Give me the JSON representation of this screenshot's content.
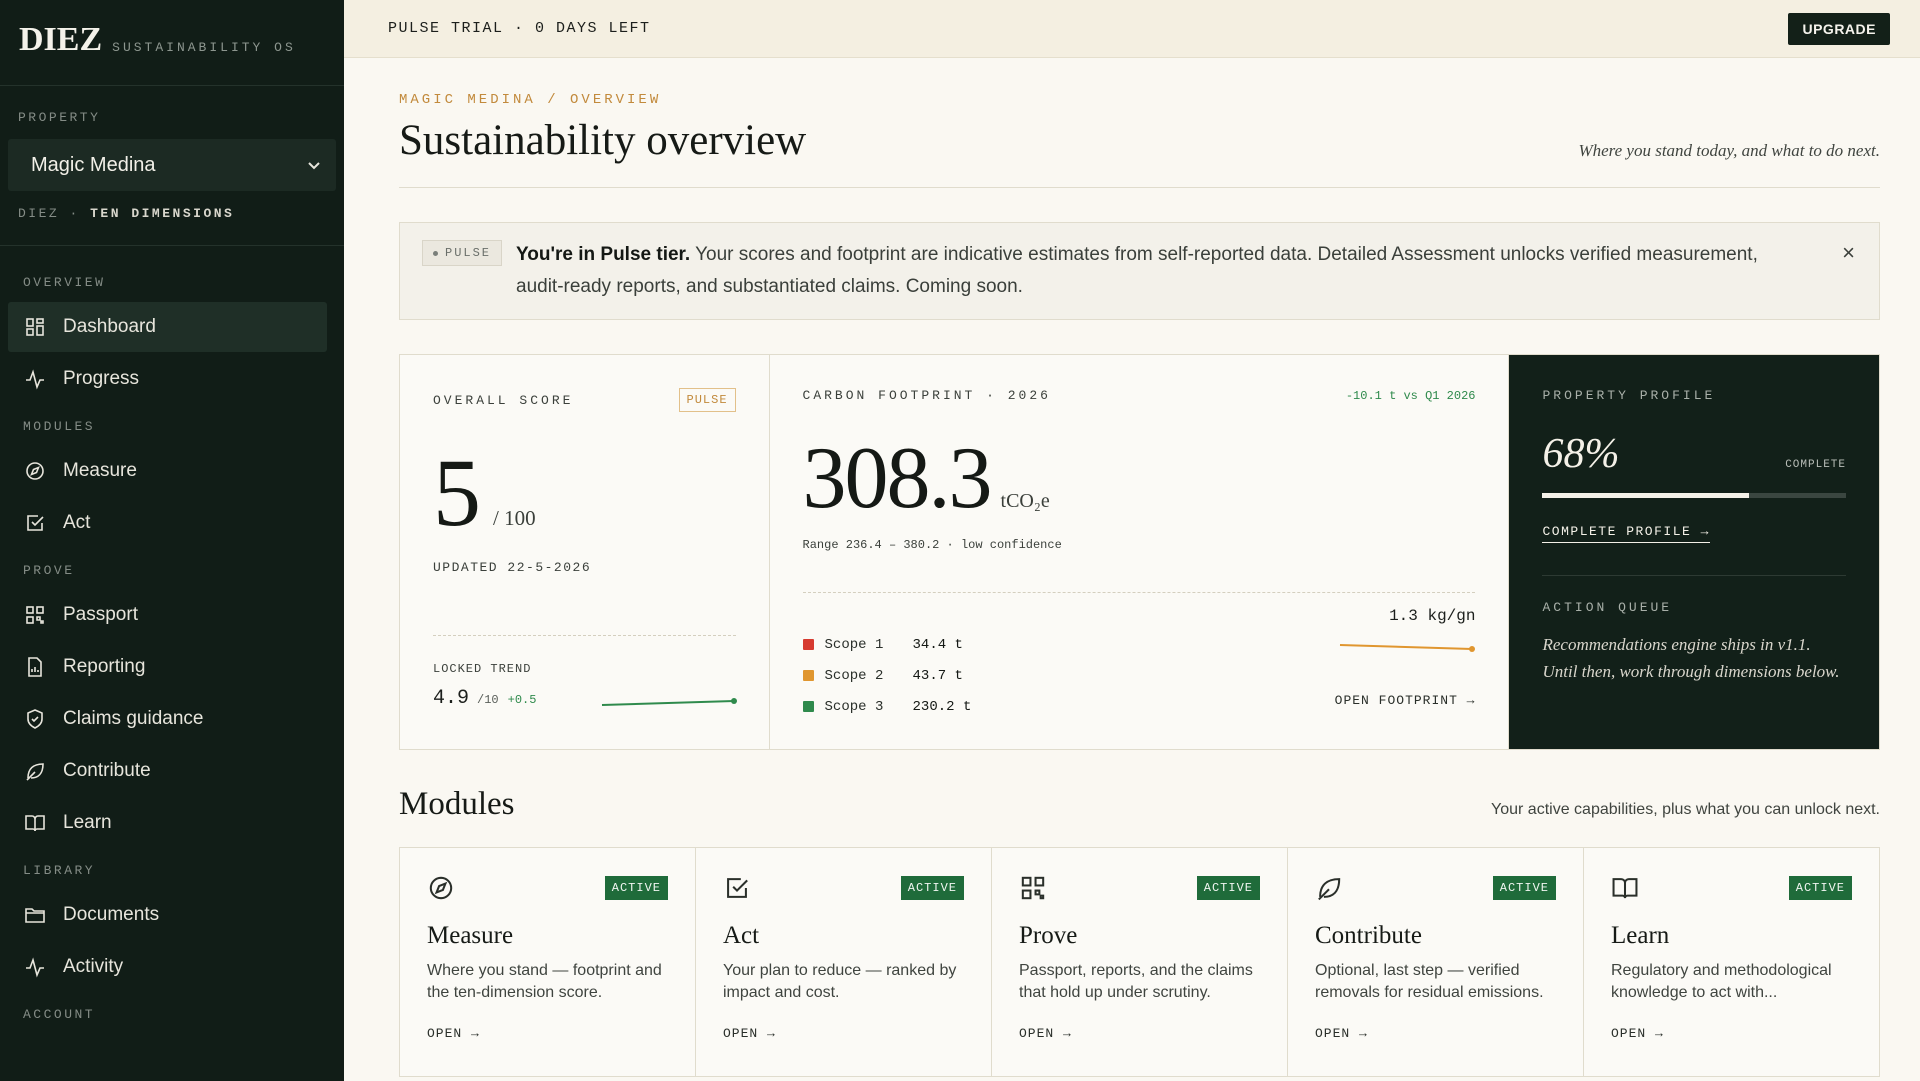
{
  "topbar": {
    "trial_text": "PULSE TRIAL · 0 DAYS LEFT",
    "upgrade_label": "UPGRADE"
  },
  "sidebar": {
    "brand": "DIEZ",
    "brand_sub": "SUSTAINABILITY OS",
    "property_label": "PROPERTY",
    "property_value": "Magic Medina",
    "property_org": "DIEZ",
    "property_sep": " · ",
    "property_org_sub": "TEN DIMENSIONS",
    "sections": {
      "overview": "OVERVIEW",
      "modules": "MODULES",
      "prove": "PROVE",
      "library": "LIBRARY",
      "account": "ACCOUNT"
    },
    "items": {
      "dashboard": "Dashboard",
      "progress": "Progress",
      "measure": "Measure",
      "act": "Act",
      "passport": "Passport",
      "reporting": "Reporting",
      "claims": "Claims guidance",
      "contribute": "Contribute",
      "learn": "Learn",
      "documents": "Documents",
      "activity": "Activity"
    }
  },
  "main": {
    "breadcrumb": "MAGIC MEDINA / OVERVIEW",
    "title": "Sustainability overview",
    "subtitle": "Where you stand today, and what to do next.",
    "banner": {
      "chip": "PULSE",
      "bold": "You're in Pulse tier.",
      "text": " Your scores and footprint are indicative estimates from self-reported data. Detailed Assessment unlocks verified measurement, audit-ready reports, and substantiated claims. Coming soon.",
      "close": "×"
    },
    "score_card": {
      "label": "OVERALL SCORE",
      "tag": "PULSE",
      "score": "5",
      "denominator": "/ 100",
      "updated": "UPDATED 22-5-2026",
      "locked_label": "LOCKED TREND",
      "trend_value": "4.9",
      "trend_den": "/10",
      "trend_delta": "+0.5"
    },
    "carbon_card": {
      "label": "CARBON FOOTPRINT · 2026",
      "delta": "-10.1 t vs Q1 2026",
      "value": "308.3",
      "unit": "tCO₂e",
      "range": "Range 236.4 – 380.2 · low confidence",
      "scopes": [
        {
          "name": "Scope 1",
          "value": "34.4 t",
          "color": "#d63a2f"
        },
        {
          "name": "Scope 2",
          "value": "43.7 t",
          "color": "#e0962f"
        },
        {
          "name": "Scope 3",
          "value": "230.2 t",
          "color": "#2f8a4c"
        }
      ],
      "intensity": "1.3 kg/gn",
      "open_link": "OPEN FOOTPRINT →"
    },
    "profile_card": {
      "label": "PROPERTY PROFILE",
      "percent": "68%",
      "fraction": 0.68,
      "complete_label": "COMPLETE",
      "link": "COMPLETE PROFILE →",
      "queue_label": "ACTION QUEUE",
      "queue_text": "Recommendations engine ships in v1.1. Until then, work through dimensions below."
    },
    "modules": {
      "title": "Modules",
      "subtitle": "Your active capabilities, plus what you can unlock next.",
      "items": [
        {
          "name": "Measure",
          "badge": "ACTIVE",
          "desc": "Where you stand — footprint and the ten-dimension score.",
          "open": "OPEN →"
        },
        {
          "name": "Act",
          "badge": "ACTIVE",
          "desc": "Your plan to reduce — ranked by impact and cost.",
          "open": "OPEN →"
        },
        {
          "name": "Prove",
          "badge": "ACTIVE",
          "desc": "Passport, reports, and the claims that hold up under scrutiny.",
          "open": "OPEN →"
        },
        {
          "name": "Contribute",
          "badge": "ACTIVE",
          "desc": "Optional, last step — verified removals for residual emissions.",
          "open": "OPEN →"
        },
        {
          "name": "Learn",
          "badge": "ACTIVE",
          "desc": "Regulatory and methodological knowledge to act with...",
          "open": "OPEN →"
        }
      ]
    }
  }
}
